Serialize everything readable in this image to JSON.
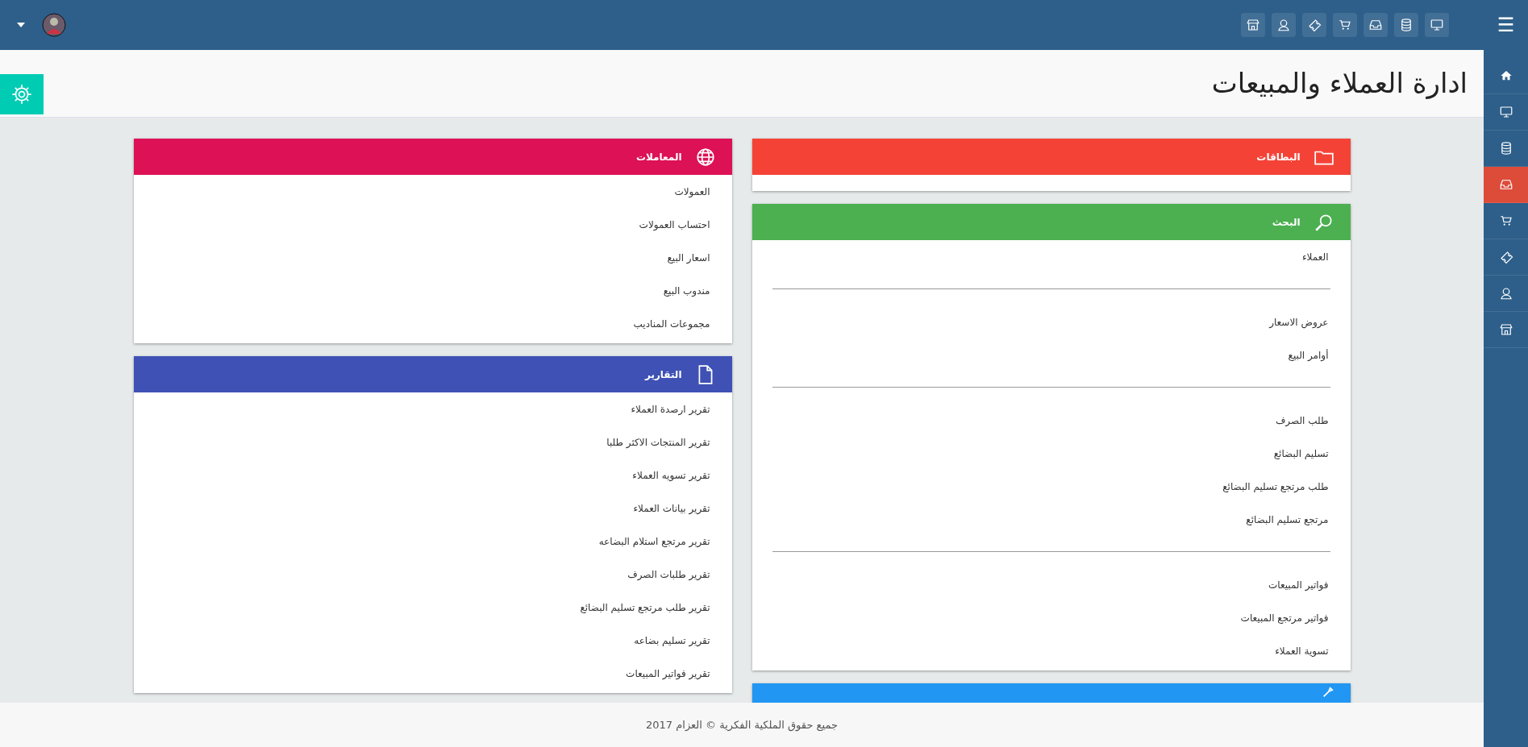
{
  "topbar": {
    "menu_icon": "☰"
  },
  "sidebar": {
    "items": [
      {
        "selected": false
      },
      {
        "selected": false
      },
      {
        "selected": false
      },
      {
        "selected": true
      },
      {
        "selected": false
      },
      {
        "selected": false
      },
      {
        "selected": false
      },
      {
        "selected": false
      }
    ]
  },
  "page_title": "ادارة العملاء والمبيعات",
  "right_column": [
    {
      "title": "البطاقات",
      "color": "#f44336"
    },
    {
      "title": "البحث",
      "color": "#4caf50",
      "items": [
        {
          "kind": "link",
          "label": "العملاء"
        },
        {
          "kind": "divider"
        },
        {
          "kind": "link",
          "label": "عروض الاسعار"
        },
        {
          "kind": "link",
          "label": "أوامر البيع"
        },
        {
          "kind": "divider"
        },
        {
          "kind": "link",
          "label": "طلب الصرف"
        },
        {
          "kind": "link",
          "label": "تسليم البضائع"
        },
        {
          "kind": "link",
          "label": "طلب مرتجع تسليم البضائع"
        },
        {
          "kind": "link",
          "label": "مرتجع تسليم البضائع"
        },
        {
          "kind": "divider"
        },
        {
          "kind": "link",
          "label": "فواتير المبيعات"
        },
        {
          "kind": "link",
          "label": "فواتير مرتجع المبيعات"
        },
        {
          "kind": "link",
          "label": "تسوية العملاء"
        }
      ]
    },
    {
      "color": "#2196f3"
    }
  ],
  "left_column": [
    {
      "title": "المعاملات",
      "color": "#dd1155",
      "items": [
        {
          "kind": "link",
          "label": "العمولات"
        },
        {
          "kind": "link",
          "label": "احتساب العمولات"
        },
        {
          "kind": "link",
          "label": "اسعار البيع"
        },
        {
          "kind": "link",
          "label": "مندوب البيع"
        },
        {
          "kind": "link",
          "label": "مجموعات المناديب"
        }
      ]
    },
    {
      "title": "التقارير",
      "color": "#3f51b5",
      "items": [
        {
          "kind": "link",
          "label": "تقرير ارصدة العملاء"
        },
        {
          "kind": "link",
          "label": "تقرير المنتجات الاكثر طلبا"
        },
        {
          "kind": "link",
          "label": "تقرير تسويه العملاء"
        },
        {
          "kind": "link",
          "label": "تقرير بيانات العملاء"
        },
        {
          "kind": "link",
          "label": "تقرير مرتجع استلام البضاعه"
        },
        {
          "kind": "link",
          "label": "تقرير طلبات الصرف"
        },
        {
          "kind": "link",
          "label": "تقرير طلب مرتجع تسليم البضائع"
        },
        {
          "kind": "link",
          "label": "تقرير تسليم بضاعه"
        },
        {
          "kind": "link",
          "label": "تقرير فواتير المبيعات"
        }
      ]
    }
  ],
  "footer": "جميع حقوق الملكية الفكرية © العزام 2017"
}
